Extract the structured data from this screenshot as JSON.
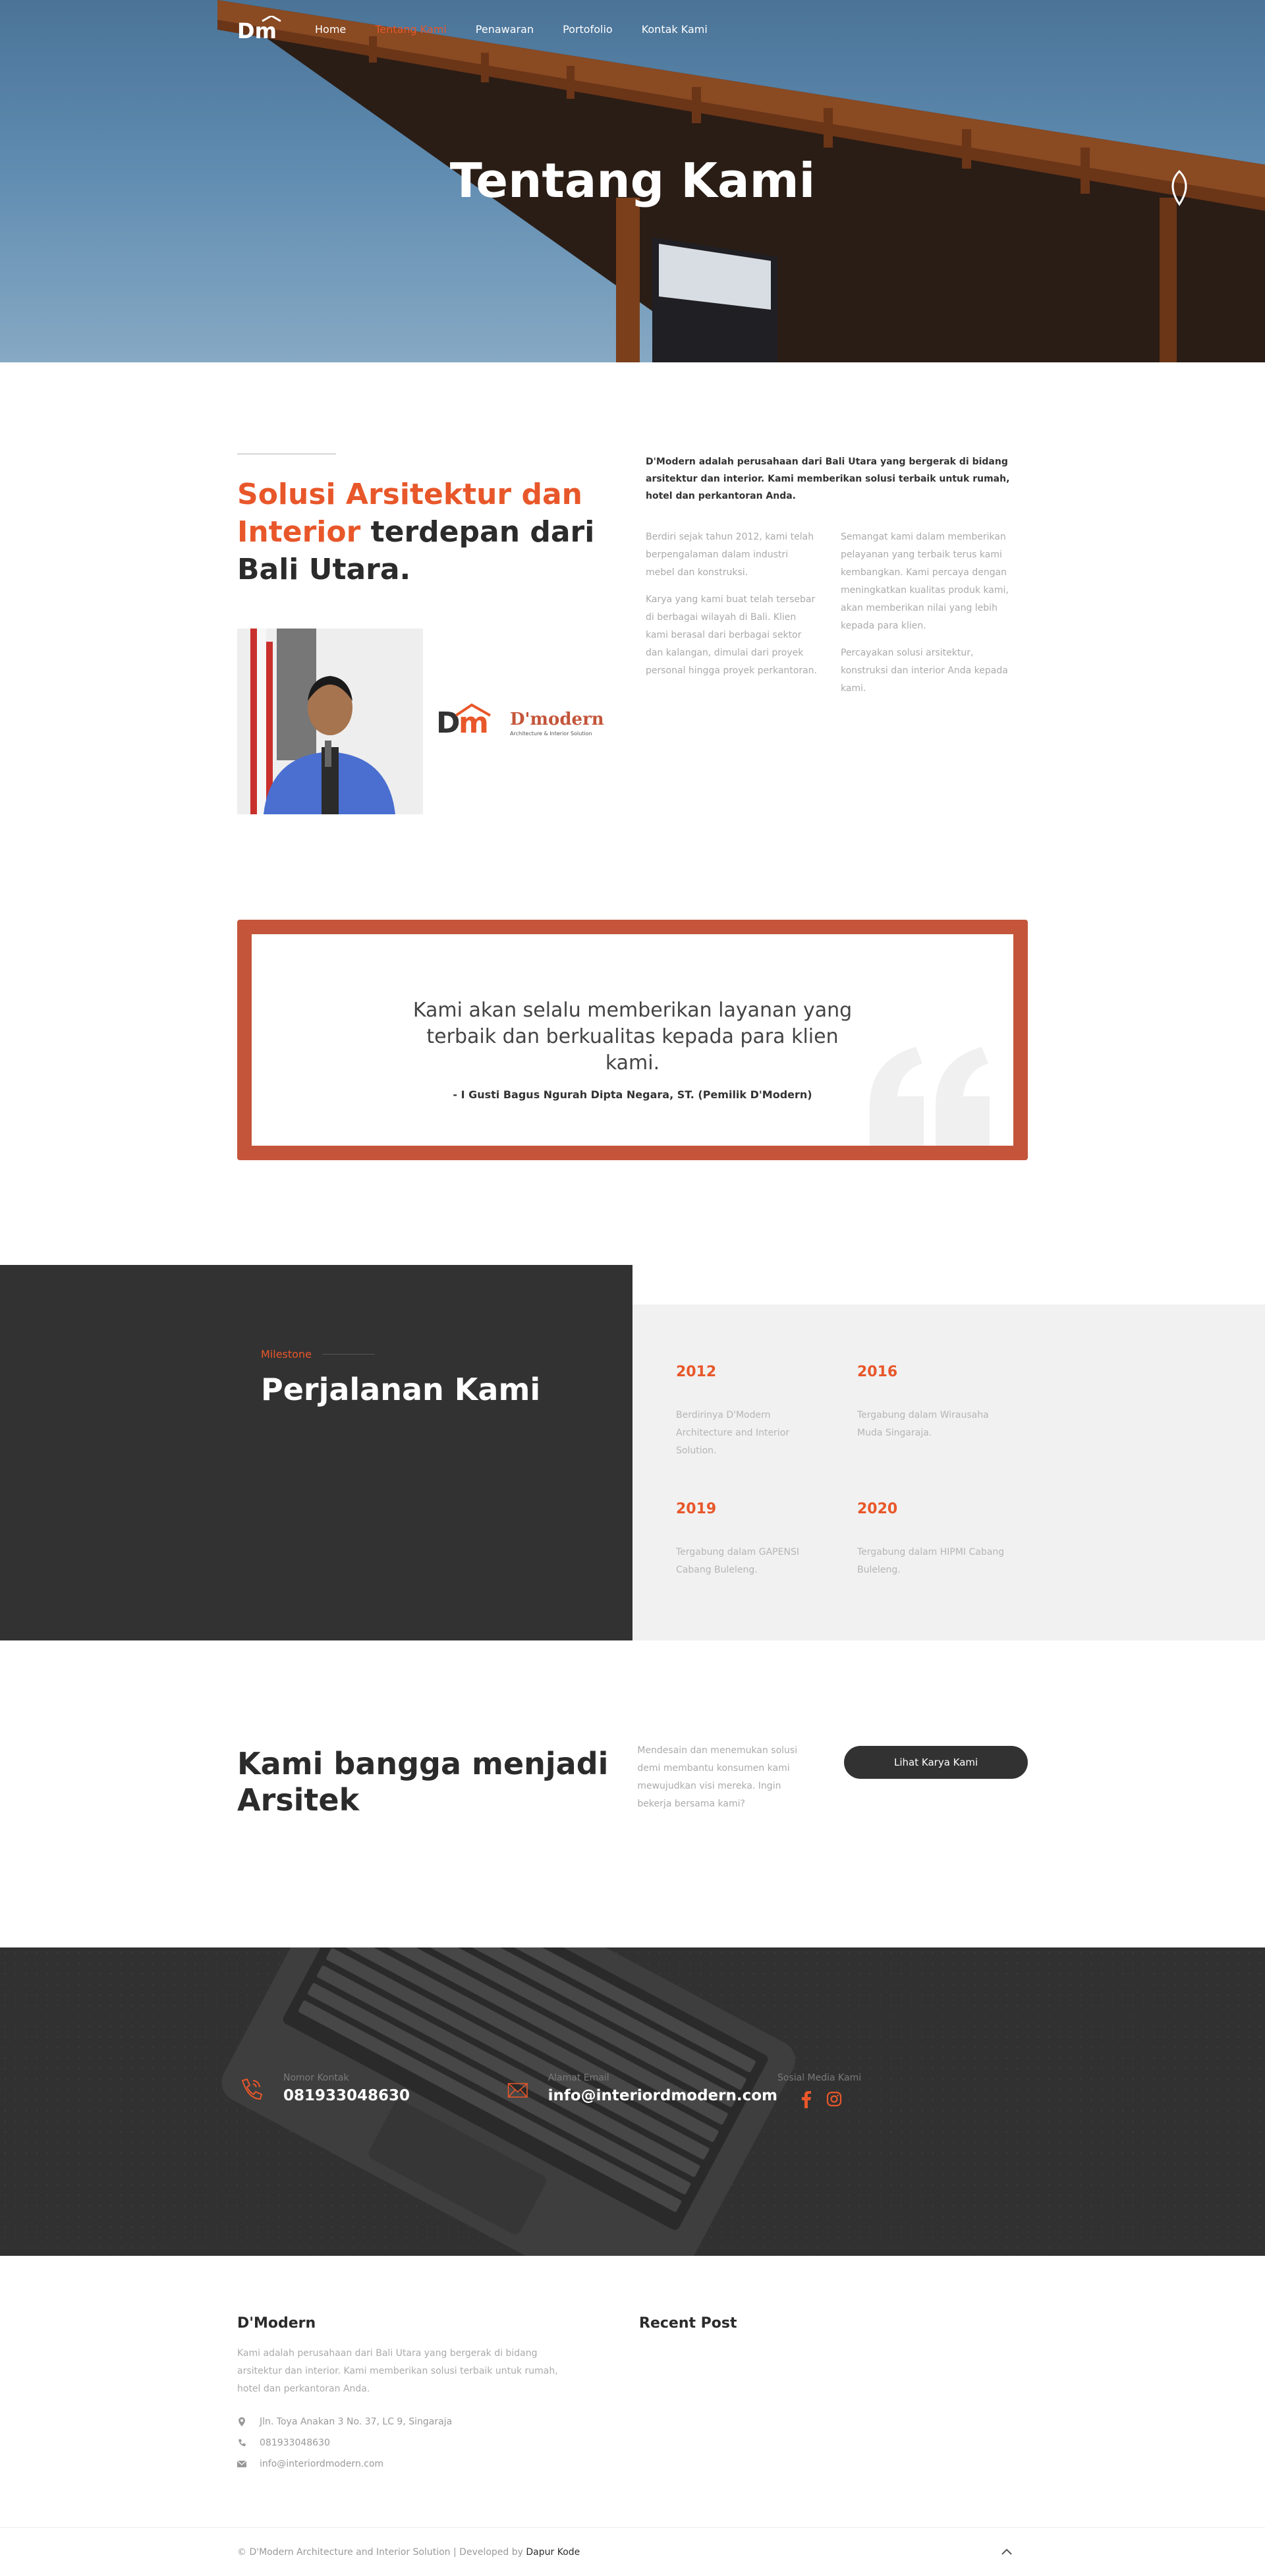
{
  "nav": {
    "logo_text": "Dm",
    "links": [
      "Home",
      "Tentang Kami",
      "Penawaran",
      "Portofolio",
      "Kontak Kami"
    ],
    "active": "Tentang Kami"
  },
  "hero": {
    "title": "Tentang Kami"
  },
  "about": {
    "heading_accent": "Solusi Arsitektur dan Interior",
    "heading_rest": "terdepan dari Bali Utara.",
    "logo_name": "D'modern",
    "logo_tagline": "Architecture & Interior Solution",
    "lead": "D'Modern adalah perusahaan dari Bali Utara yang bergerak di bidang arsitektur dan interior. Kami memberikan solusi terbaik untuk rumah, hotel dan perkantoran Anda.",
    "col1": [
      "Berdiri sejak tahun 2012, kami telah berpengalaman dalam industri mebel dan konstruksi.",
      "Karya yang kami buat telah tersebar di berbagai wilayah di Bali. Klien kami berasal dari berbagai sektor dan kalangan, dimulai dari proyek personal hingga proyek perkantoran."
    ],
    "col2": [
      "Semangat kami dalam memberikan pelayanan yang terbaik terus kami kembangkan. Kami percaya dengan meningkatkan kualitas produk kami, akan memberikan nilai yang lebih kepada para klien.",
      "Percayakan solusi arsitektur, konstruksi dan interior Anda kepada kami."
    ]
  },
  "quote": {
    "text": "Kami akan selalu memberikan layanan yang terbaik dan berkualitas kepada para klien kami.",
    "author": "- I Gusti Bagus Ngurah Dipta Negara, ST. (Pemilik D'Modern)"
  },
  "milestone": {
    "label": "Milestone",
    "title": "Perjalanan Kami",
    "items": [
      {
        "year": "2012",
        "desc": "Berdirinya D'Modern Architecture and Interior Solution."
      },
      {
        "year": "2016",
        "desc": "Tergabung dalam Wirausaha Muda Singaraja."
      },
      {
        "year": "2019",
        "desc": "Tergabung dalam GAPENSI Cabang Buleleng."
      },
      {
        "year": "2020",
        "desc": "Tergabung dalam HIPMI Cabang Buleleng."
      }
    ]
  },
  "proud": {
    "title": "Kami bangga menjadi Arsitek",
    "desc": "Mendesain dan menemukan solusi demi membantu konsumen kami mewujudkan visi mereka. Ingin bekerja bersama kami?",
    "button": "Lihat Karya Kami"
  },
  "contact": {
    "phone_label": "Nomor Kontak",
    "phone": "081933048630",
    "email_label": "Alamat Email",
    "email": "info@interiordmodern.com",
    "social_label": "Sosial Media Kami"
  },
  "footer": {
    "brand": "D'Modern",
    "about": "Kami adalah perusahaan dari Bali Utara yang bergerak di bidang arsitektur dan interior. Kami memberikan solusi terbaik untuk rumah, hotel dan perkantoran Anda.",
    "address": "Jln. Toya Anakan 3 No. 37, LC 9, Singaraja",
    "phone": "081933048630",
    "email": "info@interiordmodern.com",
    "recent_title": "Recent Post",
    "copyright": "© D'Modern Architecture and Interior Solution | Developed by",
    "developer": "Dapur Kode"
  },
  "colors": {
    "accent": "#e8572a",
    "dark": "#333233",
    "quote_frame": "#c4553a"
  }
}
